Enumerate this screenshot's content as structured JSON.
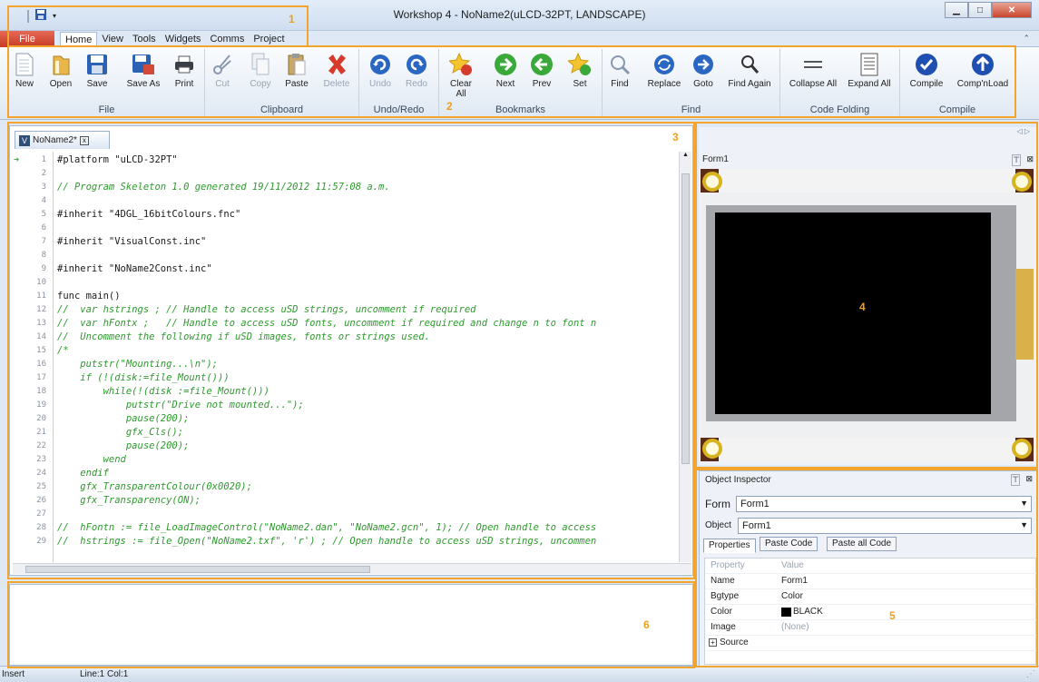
{
  "window": {
    "title": "Workshop 4 - NoName2(uLCD-32PT, LANDSCAPE)"
  },
  "ribbon_tabs": [
    "File",
    "Home",
    "View",
    "Tools",
    "Widgets",
    "Comms",
    "Project"
  ],
  "groups": {
    "file": {
      "label": "File",
      "buttons": [
        "New",
        "Open",
        "Save",
        "Save As",
        "Print"
      ]
    },
    "clipboard": {
      "label": "Clipboard",
      "buttons": [
        "Cut",
        "Copy",
        "Paste",
        "Delete"
      ]
    },
    "undo": {
      "label": "Undo/Redo",
      "buttons": [
        "Undo",
        "Redo"
      ]
    },
    "bookmarks": {
      "label": "Bookmarks",
      "buttons": [
        "Clear All",
        "Next",
        "Prev",
        "Set"
      ]
    },
    "find": {
      "label": "Find",
      "buttons": [
        "Find",
        "Replace",
        "Goto",
        "Find Again"
      ]
    },
    "folding": {
      "label": "Code Folding",
      "buttons": [
        "Collapse All",
        "Expand All"
      ]
    },
    "compile": {
      "label": "Compile",
      "buttons": [
        "Compile",
        "Comp'nLoad"
      ]
    }
  },
  "editor": {
    "tab": "NoName2*",
    "lines": [
      "#platform \"uLCD-32PT\"",
      "",
      "// Program Skeleton 1.0 generated 19/11/2012 11:57:08 a.m.",
      "",
      "#inherit \"4DGL_16bitColours.fnc\"",
      "",
      "#inherit \"VisualConst.inc\"",
      "",
      "#inherit \"NoName2Const.inc\"",
      "",
      "func main()",
      "//  var hstrings ; // Handle to access uSD strings, uncomment if required",
      "//  var hFontx ;   // Handle to access uSD fonts, uncomment if required and change n to font n",
      "//  Uncomment the following if uSD images, fonts or strings used.",
      "/*",
      "    putstr(\"Mounting...\\n\");",
      "    if (!(disk:=file_Mount()))",
      "        while(!(disk :=file_Mount()))",
      "            putstr(\"Drive not mounted...\");",
      "            pause(200);",
      "            gfx_Cls();",
      "            pause(200);",
      "        wend",
      "    endif",
      "    gfx_TransparentColour(0x0020);",
      "    gfx_Transparency(ON);",
      "",
      "//  hFontn := file_LoadImageControl(\"NoName2.dan\", \"NoName2.gcn\", 1); // Open handle to access",
      "//  hstrings := file_Open(\"NoName2.txf\", 'r') ; // Open handle to access uSD strings, uncommen"
    ]
  },
  "form_panel": {
    "title": "Form1"
  },
  "inspector": {
    "title": "Object Inspector",
    "form_label": "Form",
    "form_value": "Form1",
    "object_label": "Object",
    "object_value": "Form1",
    "tabs": [
      "Properties",
      "Paste Code",
      "Paste all Code"
    ],
    "header_property": "Property",
    "header_value": "Value",
    "rows": [
      {
        "name": "Name",
        "value": "Form1"
      },
      {
        "name": "Bgtype",
        "value": "Color"
      },
      {
        "name": "Color",
        "value": "BLACK"
      },
      {
        "name": "Image",
        "value": "(None)"
      },
      {
        "name": "Source",
        "value": ""
      }
    ]
  },
  "status": {
    "mode": "Insert",
    "position": "Line:1 Col:1"
  },
  "annotations": [
    "1",
    "2",
    "3",
    "4",
    "5",
    "6"
  ],
  "colors": {
    "accent": "#f2a42c",
    "file_tab": "#c53a25",
    "comment": "#2e9a2e",
    "string": "#2335c9",
    "keyword": "#1a1a1a"
  }
}
